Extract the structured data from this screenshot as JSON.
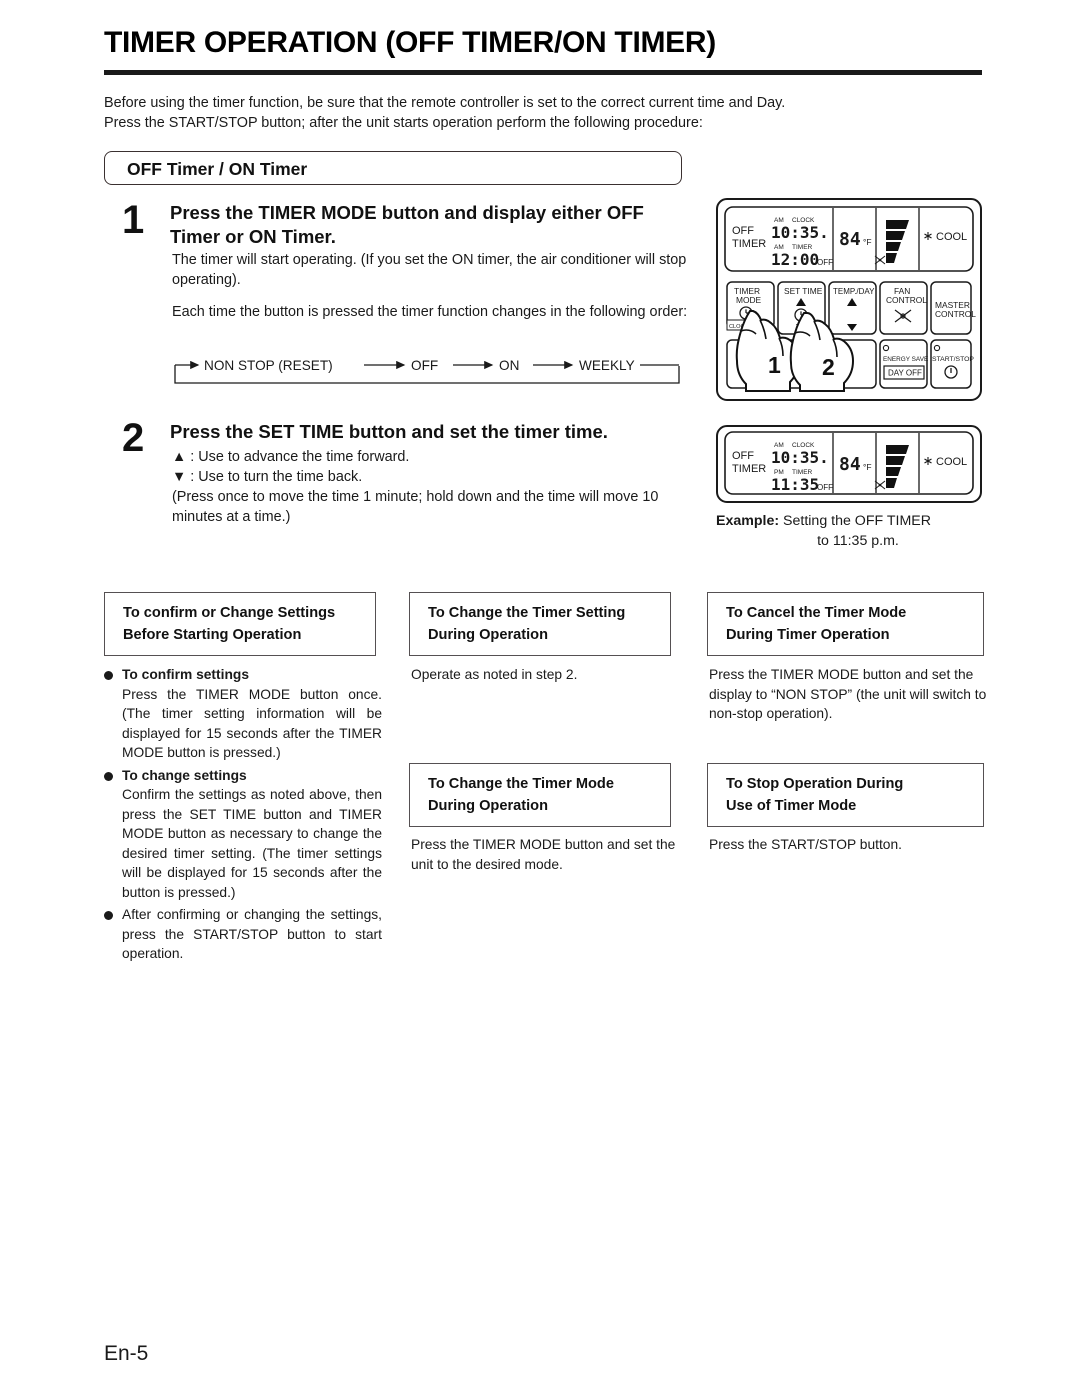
{
  "page": {
    "title": "TIMER OPERATION (OFF TIMER/ON TIMER)",
    "intro_line1": "Before using the timer function, be sure that the remote controller is set to the correct current time and Day.",
    "intro_line2": "Press the START/STOP button; after the unit starts operation perform the following procedure:",
    "footer": "En-5"
  },
  "section": {
    "pill_label": "OFF Timer / ON Timer"
  },
  "steps": [
    {
      "number": "1",
      "heading": "Press the TIMER MODE button and display either OFF Timer or ON Timer.",
      "paragraph1": "The timer will start operating. (If you set the ON timer, the air conditioner will stop operating).",
      "paragraph2": "Each time the button is pressed the timer function changes in the following order:"
    },
    {
      "number": "2",
      "heading": "Press the SET TIME button and set the timer time.",
      "line_up": "▲ : Use to advance the time forward.",
      "line_down": "▼ : Use to turn the time back.",
      "line_note": "(Press once to move the time 1 minute; hold down and the time will move 10 minutes at a time.)"
    }
  ],
  "flow": {
    "items": [
      "NON STOP (RESET)",
      "OFF",
      "ON",
      "WEEKLY"
    ]
  },
  "remote": {
    "display1": {
      "mode_line1": "OFF",
      "mode_line2": "TIMER",
      "clock_ampm": "AM",
      "clock_label": "CLOCK",
      "clock_time": "10:35.",
      "timer_ampm": "AM",
      "timer_label": "TIMER",
      "timer_time": "12:00",
      "timer_suffix": "OFF",
      "temp": "84",
      "temp_unit": "°F",
      "operation": "COOL"
    },
    "display2": {
      "mode_line1": "OFF",
      "mode_line2": "TIMER",
      "clock_ampm": "AM",
      "clock_label": "CLOCK",
      "clock_time": "10:35.",
      "timer_ampm": "PM",
      "timer_label": "TIMER",
      "timer_time": "11:35",
      "timer_suffix": "OFF",
      "temp": "84",
      "temp_unit": "°F",
      "operation": "COOL"
    },
    "buttons": {
      "timer_mode_l1": "TIMER",
      "timer_mode_l2": "MODE",
      "clock_adj": "CLOCK ADJ",
      "set_time": "SET TIME",
      "temp_day": "TEMP./DAY",
      "fan_control_l1": "FAN",
      "fan_control_l2": "CONTROL",
      "master_control_l1": "MASTER",
      "master_control_l2": "CONTROL",
      "energy_save": "ENERGY SAVE",
      "day_off": "DAY OFF",
      "start_stop": "START/STOP",
      "finger1": "1",
      "finger2": "2"
    }
  },
  "example": {
    "label": "Example:",
    "line1": " Setting the OFF TIMER",
    "line2": "to 11:35 p.m."
  },
  "columns": {
    "a": {
      "box_line1": "To confirm or Change Settings",
      "box_line2": "Before Starting Operation",
      "items": [
        {
          "head": "To confirm settings",
          "body": "Press the TIMER MODE button once. (The timer setting information will be displayed for 15 seconds after the TIMER MODE button is pressed.)"
        },
        {
          "head": "To change settings",
          "body": "Confirm the settings as noted above, then press the SET TIME button and TIMER MODE button as necessary to change the desired timer setting. (The timer settings will be displayed for 15 seconds after the button is pressed.)"
        },
        {
          "head": "",
          "body": "After confirming or changing the settings, press the START/STOP button to start operation."
        }
      ]
    },
    "b1": {
      "box_line1": "To Change the Timer Setting",
      "box_line2": "During Operation",
      "text": "Operate as noted in step 2."
    },
    "b2": {
      "box_line1": "To Change the Timer Mode",
      "box_line2": "During Operation",
      "text": "Press the TIMER MODE button and set the unit to the desired mode."
    },
    "c1": {
      "box_line1": "To Cancel the Timer Mode",
      "box_line2": "During Timer Operation",
      "text": "Press the TIMER MODE button and set the display to “NON STOP” (the unit will switch to non-stop operation)."
    },
    "c2": {
      "box_line1": "To Stop Operation During",
      "box_line2": "Use of Timer Mode",
      "text": "Press the START/STOP button."
    }
  }
}
